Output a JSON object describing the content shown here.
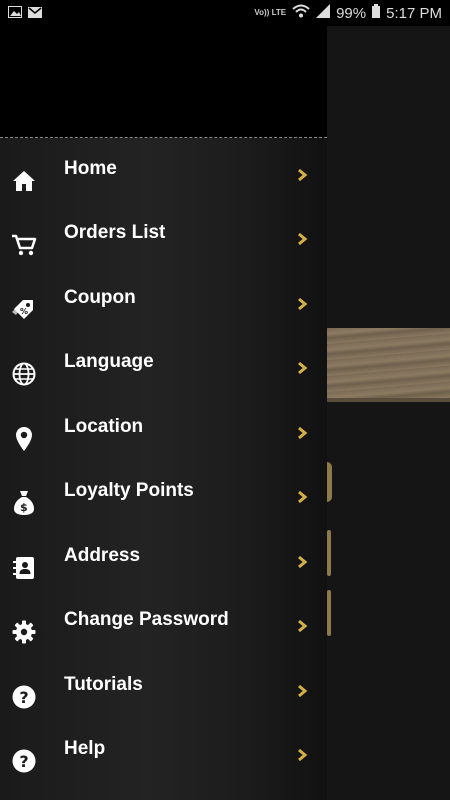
{
  "status_bar": {
    "time": "5:17 PM",
    "battery": "99%",
    "network": "Vo)) LTE",
    "icons": [
      "image-icon",
      "gmail-icon",
      "wifi-icon",
      "signal-icon",
      "battery-icon"
    ]
  },
  "drawer": {
    "accent_color": "#d4b04a",
    "items": [
      {
        "label": "Home",
        "icon": "home-icon"
      },
      {
        "label": "Orders List",
        "icon": "cart-icon"
      },
      {
        "label": "Coupon",
        "icon": "coupon-icon"
      },
      {
        "label": "Language",
        "icon": "globe-icon"
      },
      {
        "label": "Location",
        "icon": "location-pin-icon"
      },
      {
        "label": "Loyalty Points",
        "icon": "money-bag-icon"
      },
      {
        "label": "Address",
        "icon": "contact-book-icon"
      },
      {
        "label": "Change Password",
        "icon": "gear-icon"
      },
      {
        "label": "Tutorials",
        "icon": "help-circle-icon"
      },
      {
        "label": "Help",
        "icon": "help-circle-icon"
      }
    ]
  }
}
